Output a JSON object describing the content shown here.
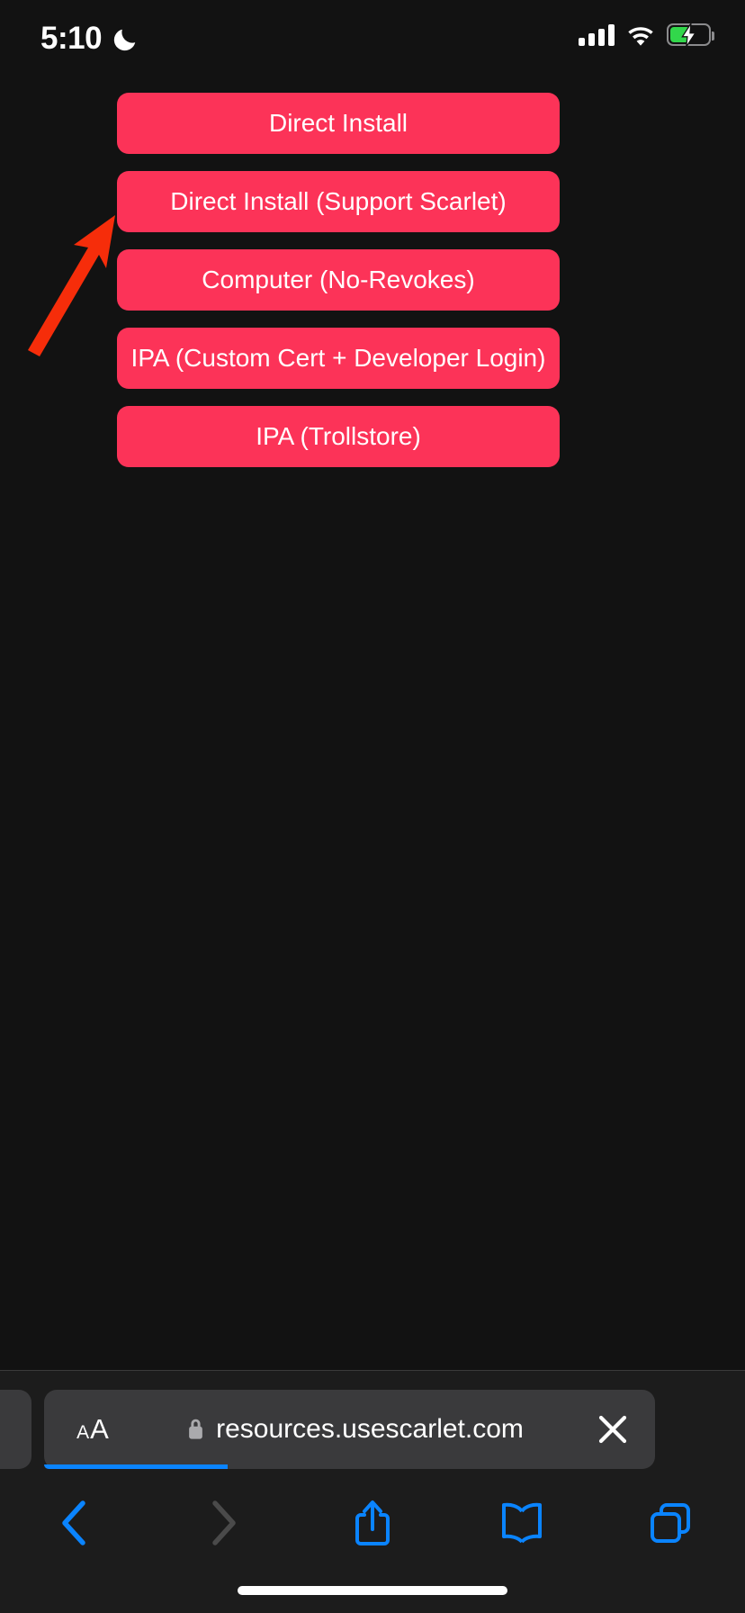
{
  "status_bar": {
    "time": "5:10",
    "dnd_icon": "crescent-moon-icon",
    "cellular_icon": "cellular-bars-icon",
    "wifi_icon": "wifi-icon",
    "battery_icon": "battery-charging-icon",
    "battery_level_percent": 48,
    "battery_color": "#32d74b",
    "battery_charging": true
  },
  "page": {
    "background_color": "#121212",
    "accent_color": "#fc3358",
    "buttons": [
      {
        "label": "Direct Install"
      },
      {
        "label": "Direct Install (Support Scarlet)"
      },
      {
        "label": "Computer (No-Revokes)"
      },
      {
        "label": "IPA (Custom Cert + Developer Login)"
      },
      {
        "label": "IPA (Trollstore)"
      }
    ]
  },
  "annotation": {
    "name": "red-arrow-pointing-to-direct-install",
    "color": "#f62d0a",
    "points_to": "Direct Install"
  },
  "browser": {
    "address_bar": {
      "text_size_small_label": "A",
      "text_size_large_label": "A",
      "lock_icon": "lock-icon",
      "url": "resources.usescarlet.com",
      "stop_icon": "close-x-icon",
      "progress_percent": 30,
      "progress_color": "#0a84ff"
    },
    "toolbar": {
      "back_icon": "chevron-left-icon",
      "back_enabled": true,
      "forward_icon": "chevron-right-icon",
      "forward_enabled": false,
      "share_icon": "share-icon",
      "bookmarks_icon": "book-icon",
      "tabs_icon": "tabs-icon",
      "active_color": "#0a84ff",
      "disabled_color": "#4a4a4a"
    }
  }
}
